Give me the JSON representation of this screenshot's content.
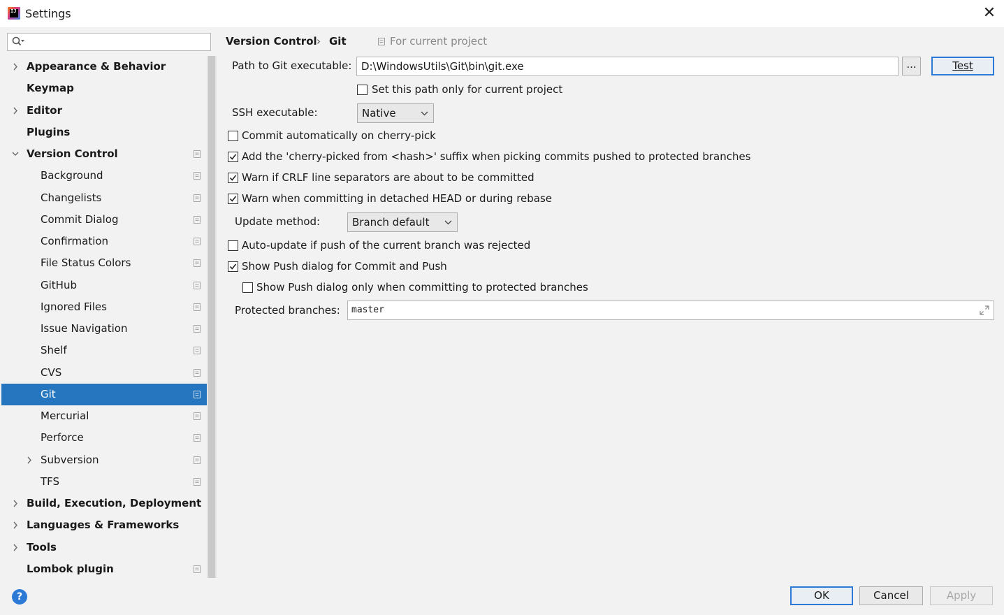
{
  "window": {
    "title": "Settings"
  },
  "sidebar": {
    "search": {
      "value": ""
    },
    "items": [
      {
        "label": "Appearance & Behavior",
        "bold": true,
        "level": 0,
        "chevron": "right",
        "project_icon": false
      },
      {
        "label": "Keymap",
        "bold": true,
        "level": 0,
        "chevron": "",
        "project_icon": false
      },
      {
        "label": "Editor",
        "bold": true,
        "level": 0,
        "chevron": "right",
        "project_icon": false
      },
      {
        "label": "Plugins",
        "bold": true,
        "level": 0,
        "chevron": "",
        "project_icon": false
      },
      {
        "label": "Version Control",
        "bold": true,
        "level": 0,
        "chevron": "down",
        "project_icon": true
      },
      {
        "label": "Background",
        "bold": false,
        "level": 1,
        "chevron": "",
        "project_icon": true
      },
      {
        "label": "Changelists",
        "bold": false,
        "level": 1,
        "chevron": "",
        "project_icon": true
      },
      {
        "label": "Commit Dialog",
        "bold": false,
        "level": 1,
        "chevron": "",
        "project_icon": true
      },
      {
        "label": "Confirmation",
        "bold": false,
        "level": 1,
        "chevron": "",
        "project_icon": true
      },
      {
        "label": "File Status Colors",
        "bold": false,
        "level": 1,
        "chevron": "",
        "project_icon": true
      },
      {
        "label": "GitHub",
        "bold": false,
        "level": 1,
        "chevron": "",
        "project_icon": true
      },
      {
        "label": "Ignored Files",
        "bold": false,
        "level": 1,
        "chevron": "",
        "project_icon": true
      },
      {
        "label": "Issue Navigation",
        "bold": false,
        "level": 1,
        "chevron": "",
        "project_icon": true
      },
      {
        "label": "Shelf",
        "bold": false,
        "level": 1,
        "chevron": "",
        "project_icon": true
      },
      {
        "label": "CVS",
        "bold": false,
        "level": 1,
        "chevron": "",
        "project_icon": true
      },
      {
        "label": "Git",
        "bold": false,
        "level": 1,
        "chevron": "",
        "project_icon": true,
        "selected": true
      },
      {
        "label": "Mercurial",
        "bold": false,
        "level": 1,
        "chevron": "",
        "project_icon": true
      },
      {
        "label": "Perforce",
        "bold": false,
        "level": 1,
        "chevron": "",
        "project_icon": true
      },
      {
        "label": "Subversion",
        "bold": false,
        "level": 1,
        "chevron": "right",
        "project_icon": true
      },
      {
        "label": "TFS",
        "bold": false,
        "level": 1,
        "chevron": "",
        "project_icon": true
      },
      {
        "label": "Build, Execution, Deployment",
        "bold": true,
        "level": 0,
        "chevron": "right",
        "project_icon": false
      },
      {
        "label": "Languages & Frameworks",
        "bold": true,
        "level": 0,
        "chevron": "right",
        "project_icon": false
      },
      {
        "label": "Tools",
        "bold": true,
        "level": 0,
        "chevron": "right",
        "project_icon": false
      },
      {
        "label": "Lombok plugin",
        "bold": true,
        "level": 0,
        "chevron": "",
        "project_icon": true
      }
    ]
  },
  "breadcrumb": {
    "parent": "Version Control",
    "separator": "›",
    "current": "Git",
    "scope": "For current project"
  },
  "git": {
    "path_label": "Path to Git executable:",
    "path_value": "D:\\WindowsUtils\\Git\\bin\\git.exe",
    "browse_label": "...",
    "test_label": "Test",
    "set_path_only": {
      "label": "Set this path only for current project",
      "checked": false
    },
    "ssh_label": "SSH executable:",
    "ssh_value": "Native",
    "commit_auto": {
      "label": "Commit automatically on cherry-pick",
      "checked": false
    },
    "cherry_suffix": {
      "label": "Add the 'cherry-picked from <hash>' suffix when picking commits pushed to protected branches",
      "checked": true
    },
    "warn_crlf": {
      "label": "Warn if CRLF line separators are about to be committed",
      "checked": true
    },
    "warn_detached": {
      "label": "Warn when committing in detached HEAD or during rebase",
      "checked": true
    },
    "update_label": "Update method:",
    "update_value": "Branch default",
    "auto_update": {
      "label": "Auto-update if push of the current branch was rejected",
      "checked": false
    },
    "show_push": {
      "label": "Show Push dialog for Commit and Push",
      "checked": true
    },
    "show_push_protected": {
      "label": "Show Push dialog only when committing to protected branches",
      "checked": false
    },
    "protected_label": "Protected branches:",
    "protected_value": "master"
  },
  "footer": {
    "ok_label": "OK",
    "cancel_label": "Cancel",
    "apply_label": "Apply",
    "help_label": "?"
  },
  "colors": {
    "accent": "#2675bf",
    "selection": "#2675bf",
    "button_focus": "#2c7ad6"
  }
}
